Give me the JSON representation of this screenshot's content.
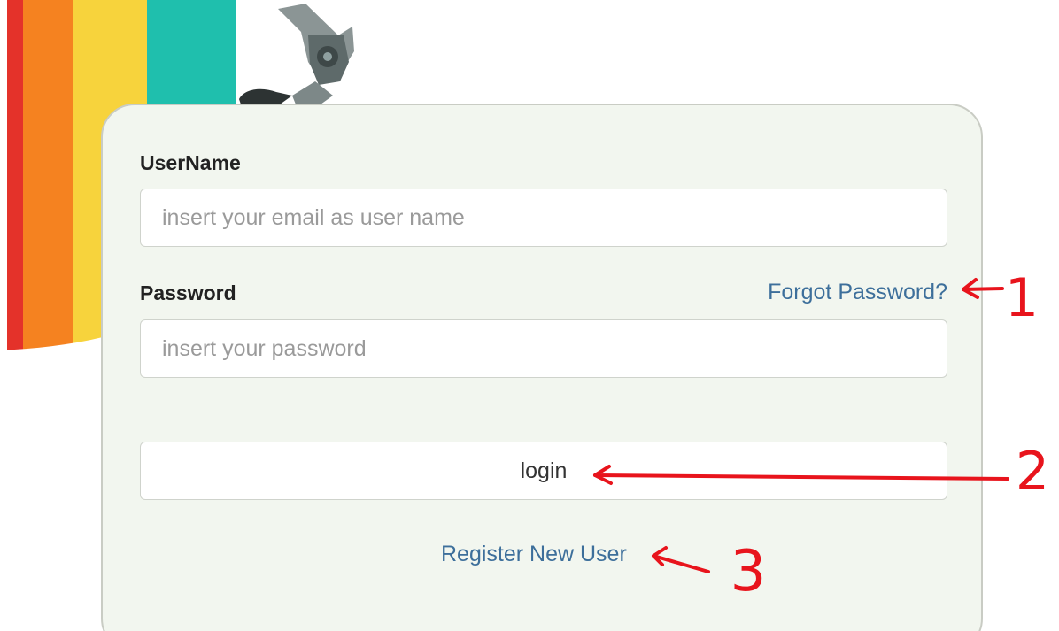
{
  "login_form": {
    "username_label": "UserName",
    "username_placeholder": "insert your email as user name",
    "password_label": "Password",
    "password_placeholder": "insert your password",
    "forgot_password_link": "Forgot Password?",
    "login_button": "login",
    "register_link": "Register New User"
  },
  "annotations": [
    "1",
    "2",
    "3"
  ],
  "colors": {
    "panel_background": "#f2f6ef",
    "link": "#3d6f9b",
    "annotation": "#e8141c"
  }
}
